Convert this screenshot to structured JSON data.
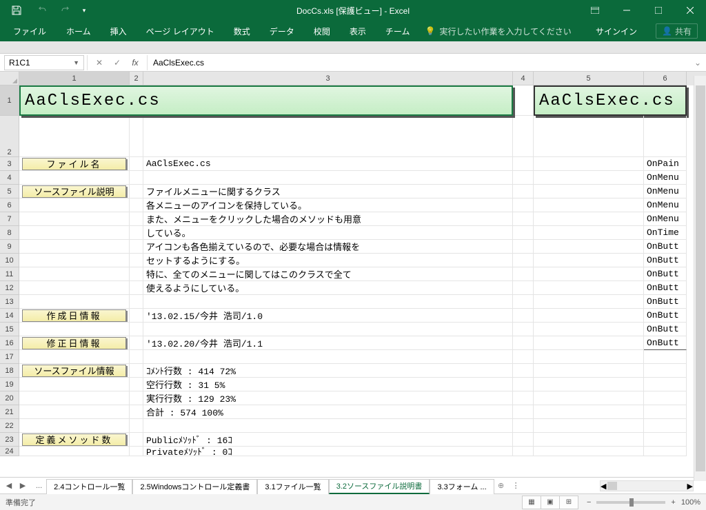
{
  "window": {
    "title": "DocCs.xls [保護ビュー] - Excel",
    "signin": "サインイン",
    "share": "共有"
  },
  "tabs": {
    "file": "ファイル",
    "home": "ホーム",
    "insert": "挿入",
    "pagelayout": "ページ レイアウト",
    "formulas": "数式",
    "data": "データ",
    "review": "校閲",
    "view": "表示",
    "team": "チーム",
    "tellme": "実行したい作業を入力してください"
  },
  "fx": {
    "namebox": "R1C1",
    "formula": "AaClsExec.cs"
  },
  "cols": [
    "1",
    "2",
    "3",
    "4",
    "5",
    "6"
  ],
  "rows": [
    "1",
    "2",
    "3",
    "4",
    "5",
    "6",
    "7",
    "8",
    "9",
    "10",
    "11",
    "12",
    "13",
    "14",
    "15",
    "16",
    "17",
    "18",
    "19",
    "20",
    "21",
    "22",
    "23",
    "24"
  ],
  "sheet": {
    "title_a": "AaClsExec.cs",
    "title_b": "AaClsExec.cs",
    "labels": {
      "filename": "ファイル名",
      "srcdesc": "ソースファイル説明",
      "created": "作成日情報",
      "modified": "修正日情報",
      "srcinfo": "ソースファイル情報",
      "methods": "定義メソッド数"
    },
    "vals": {
      "filename": "AaClsExec.cs",
      "desc1": "ファイルメニューに関するクラス",
      "desc2": "各メニューのアイコンを保持している。",
      "desc3": "また、メニューをクリックした場合のメソッドも用意",
      "desc4": "している。",
      "desc5": "アイコンも各色揃えているので、必要な場合は情報を",
      "desc6": "セットするようにする。",
      "desc7": "特に、全てのメニューに関してはこのクラスで全て",
      "desc8": "使えるようにしている。",
      "created": "'13.02.15/今井 浩司/1.0",
      "modified": "'13.02.20/今井 浩司/1.1",
      "stat1": "ｺﾒﾝﾄ行数  :   414   72%",
      "stat2": "空行行数  :    31    5%",
      "stat3": "実行行数  :   129   23%",
      "stat4": "合計      :   574  100%",
      "meth1": "Publicﾒｿｯﾄﾞ    :  16ｺ",
      "meth2": "Privateﾒｿｯﾄﾞ   :   0ｺ"
    },
    "col6": {
      "r3": "OnPain",
      "r4": "OnMenu",
      "r5": "OnMenu",
      "r6": "OnMenu",
      "r7": "OnMenu",
      "r8": "OnTime",
      "r9": "OnButt",
      "r10": "OnButt",
      "r11": "OnButt",
      "r12": "OnButt",
      "r13": "OnButt",
      "r14": "OnButt",
      "r15": "OnButt",
      "r16": "OnButt"
    }
  },
  "sheettabs": {
    "t1": "2.4コントロール一覧",
    "t2": "2.5Windowsコントロール定義書",
    "t3": "3.1ファイル一覧",
    "t4": "3.2ソースファイル説明書",
    "t5": "3.3フォーム ..."
  },
  "status": {
    "ready": "準備完了",
    "zoom": "100%"
  }
}
